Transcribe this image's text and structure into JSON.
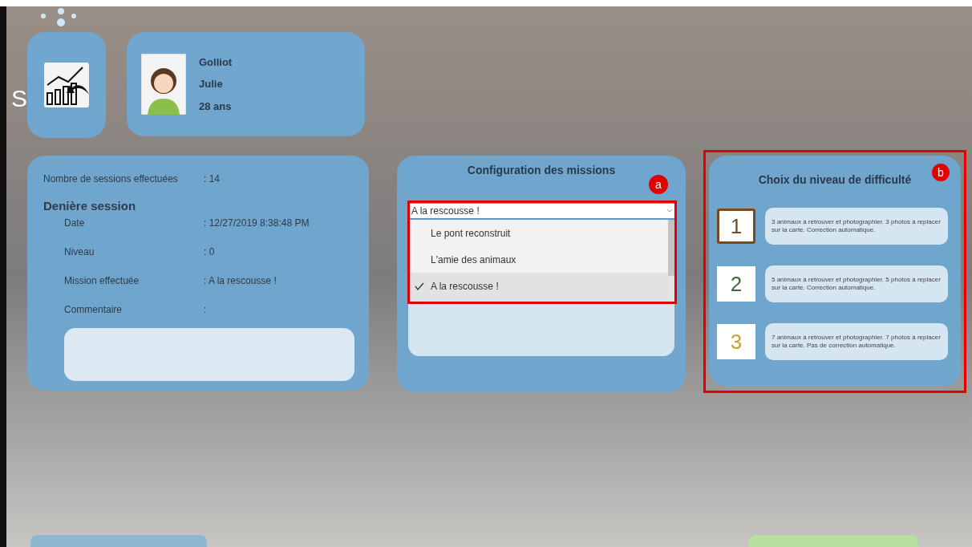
{
  "title_fragment": "S",
  "profile": {
    "last_name": "Golliot",
    "first_name": "Julie",
    "age": "28 ans"
  },
  "history": {
    "sessions_label": "Nombre de sessions effectuées",
    "sessions_value": ": 14",
    "last_session_title": "Denière session",
    "rows": [
      {
        "label": "Date",
        "value": ": 12/27/2019 8:38:48 PM"
      },
      {
        "label": "Niveau",
        "value": ": 0"
      },
      {
        "label": "Mission effectuée",
        "value": ": A la rescousse !"
      },
      {
        "label": "Commentaire",
        "value": ":"
      }
    ]
  },
  "missions": {
    "title": "Configuration des missions",
    "dropdown_value": "A la rescousse !",
    "options": [
      {
        "label": "Le pont reconstruit",
        "selected": false
      },
      {
        "label": "L'amie des animaux",
        "selected": false
      },
      {
        "label": "A la rescousse !",
        "selected": true
      }
    ]
  },
  "difficulty": {
    "title": "Choix du niveau de difficulté",
    "levels": [
      {
        "number": "1",
        "color": "#7a4a1e",
        "selected": true,
        "description": "3 animaux à retrouver et photographier. 3 photos à replacer sur la carte. Correction automatique."
      },
      {
        "number": "2",
        "color": "#3f6b3a",
        "selected": false,
        "description": "5 animaux à retrouver et photographier. 5 photos à replacer sur la carte. Correction automatique."
      },
      {
        "number": "3",
        "color": "#c9a227",
        "selected": false,
        "description": "7 animaux à retrouver et photographier. 7 photos à replacer sur la carte. Pas de correction automatique."
      }
    ]
  },
  "annotations": [
    {
      "label": "a"
    },
    {
      "label": "b"
    }
  ]
}
